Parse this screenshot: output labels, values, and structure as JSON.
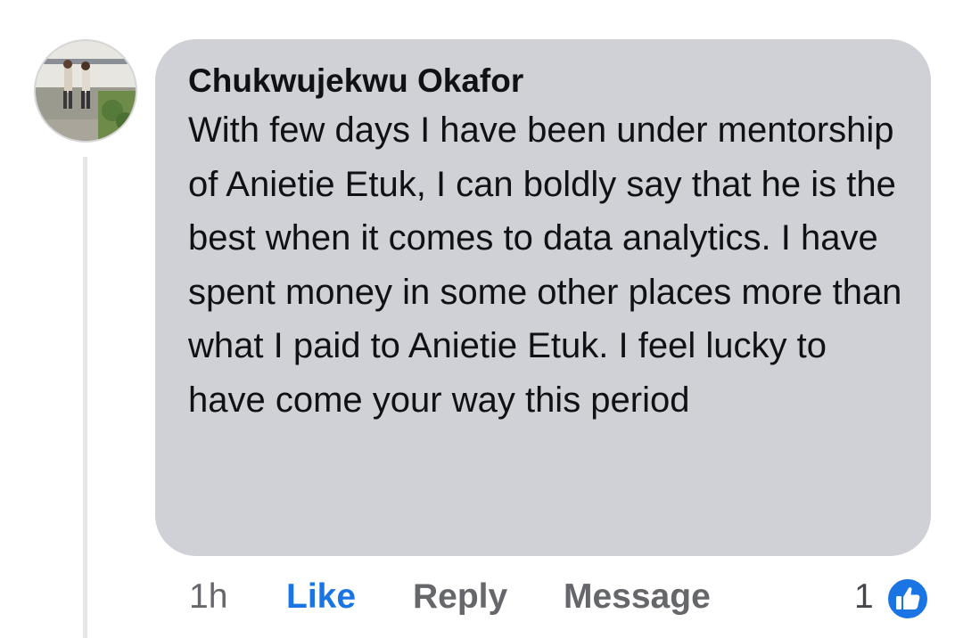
{
  "comment": {
    "author": "Chukwujekwu Okafor",
    "text": "With few days I have been under mentorship of Anietie Etuk, I can boldly say that he is the best when it comes to data analytics. I have spent money in some other places more than what I paid to Anietie Etuk. I feel lucky to have come your way this period",
    "time": "1h",
    "reaction_count": "1",
    "reaction_icon": "thumbs-up-icon"
  },
  "actions": {
    "like_label": "Like",
    "reply_label": "Reply",
    "message_label": "Message"
  },
  "colors": {
    "bubble_bg": "#cfd1d6",
    "like_blue": "#1b74e4",
    "meta_grey": "#65676b",
    "text": "#101114"
  }
}
